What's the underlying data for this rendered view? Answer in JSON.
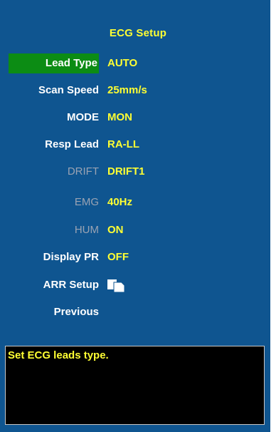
{
  "title": "ECG Setup",
  "rows": [
    {
      "label": "Lead Type",
      "value": "AUTO"
    },
    {
      "label": "Scan Speed",
      "value": "25mm/s"
    },
    {
      "label": "MODE",
      "value": "MON"
    },
    {
      "label": "Resp Lead",
      "value": "RA-LL"
    },
    {
      "label": "DRIFT",
      "value": "DRIFT1"
    },
    {
      "label": "EMG",
      "value": "40Hz"
    },
    {
      "label": "HUM",
      "value": "ON"
    },
    {
      "label": "Display PR",
      "value": "OFF"
    },
    {
      "label": "ARR Setup",
      "icon": "copy-pages-icon"
    },
    {
      "label": "Previous"
    }
  ],
  "help_text": "Set ECG leads type.",
  "colors": {
    "panel_bg": "#0f5590",
    "selected_bg": "#0c8c14",
    "value_text": "#ffff33",
    "label_text": "#ffffff",
    "disabled_text": "#9aa3b3",
    "help_bg": "#000000"
  }
}
